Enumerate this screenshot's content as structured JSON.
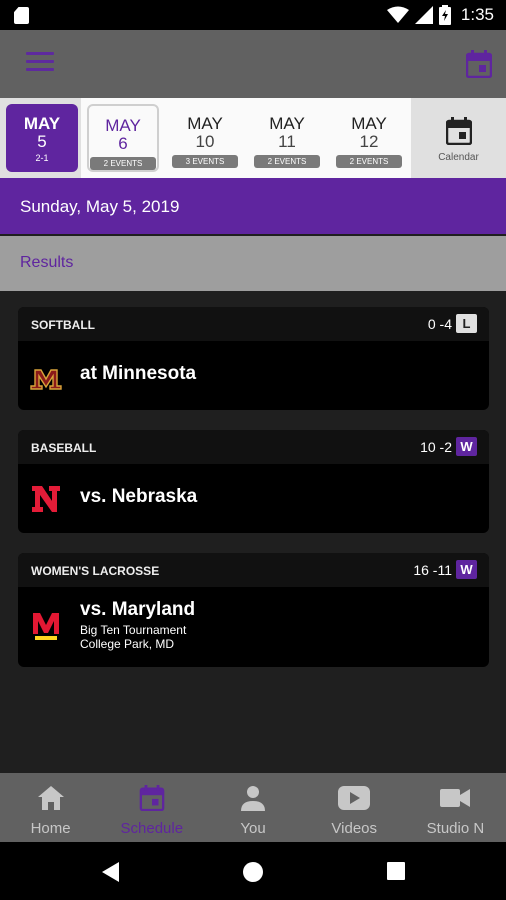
{
  "status_bar": {
    "time": "1:35"
  },
  "app_bar": {
    "menu_icon": "hamburger-menu-icon",
    "calendar_icon": "calendar-icon"
  },
  "date_strip": {
    "selected": {
      "month": "MAY",
      "day": "5",
      "record": "2-1"
    },
    "dates": [
      {
        "month": "MAY",
        "day": "6",
        "events": "2 EVENTS",
        "active": true
      },
      {
        "month": "MAY",
        "day": "10",
        "events": "3 EVENTS",
        "active": false
      },
      {
        "month": "MAY",
        "day": "11",
        "events": "2 EVENTS",
        "active": false
      },
      {
        "month": "MAY",
        "day": "12",
        "events": "2 EVENTS",
        "active": false
      }
    ],
    "calendar_label": "Calendar"
  },
  "date_header": "Sunday, May 5, 2019",
  "results_label": "Results",
  "games": [
    {
      "sport": "SOFTBALL",
      "score": "0 -4",
      "result": "L",
      "opponent": "at Minnesota",
      "details": []
    },
    {
      "sport": "BASEBALL",
      "score": "10 -2",
      "result": "W",
      "opponent": "vs. Nebraska",
      "details": []
    },
    {
      "sport": "WOMEN'S LACROSSE",
      "score": "16 -11",
      "result": "W",
      "opponent": "vs. Maryland",
      "details": [
        "Big Ten Tournament",
        "College Park, MD"
      ]
    }
  ],
  "bottom_nav": [
    {
      "label": "Home",
      "icon": "home-icon",
      "active": false
    },
    {
      "label": "Schedule",
      "icon": "calendar-icon",
      "active": true
    },
    {
      "label": "You",
      "icon": "person-icon",
      "active": false
    },
    {
      "label": "Videos",
      "icon": "play-icon",
      "active": false
    },
    {
      "label": "Studio N",
      "icon": "videocam-icon",
      "active": false
    }
  ],
  "colors": {
    "primary": "#5f259f",
    "win": "#5f259f",
    "loss": "#e0e0e0"
  }
}
